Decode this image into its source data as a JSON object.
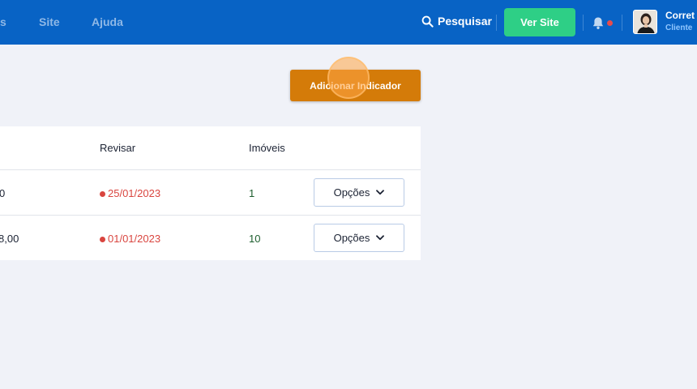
{
  "nav": {
    "items": [
      {
        "label": "s"
      },
      {
        "label": "Site"
      },
      {
        "label": "Ajuda"
      }
    ],
    "search_label": "Pesquisar",
    "view_site_label": "Ver Site",
    "user": {
      "name": "Corret",
      "role": "Cliente"
    },
    "icons": {
      "search": "search-icon",
      "notifications": "bell-icon",
      "dropdown": "chevron-down-icon"
    },
    "notification_dot_color": "#e74c4c"
  },
  "actions": {
    "add_label": "Adicionar Indicador"
  },
  "table": {
    "headers": {
      "review": "Revisar",
      "properties": "Imóveis"
    },
    "rows": [
      {
        "value": "0",
        "review_date": "25/01/2023",
        "properties": "1",
        "options_label": "Opções"
      },
      {
        "value": "8,00",
        "review_date": "01/01/2023",
        "properties": "10",
        "options_label": "Opções"
      }
    ]
  },
  "colors": {
    "topbar": "#0863c5",
    "accent_green": "#2ecf86",
    "accent_orange": "#d47b09",
    "overdue_red": "#d9453f"
  }
}
